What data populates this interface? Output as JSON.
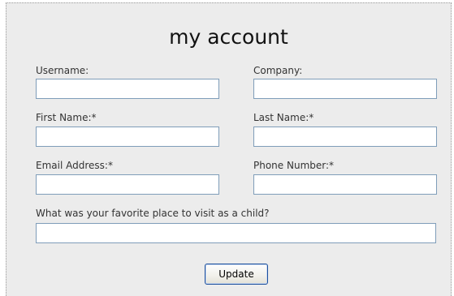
{
  "form": {
    "title": "my account",
    "fields": {
      "username": {
        "label": "Username:",
        "value": ""
      },
      "company": {
        "label": "Company:",
        "value": ""
      },
      "first_name": {
        "label": "First Name:*",
        "value": ""
      },
      "last_name": {
        "label": "Last Name:*",
        "value": ""
      },
      "email": {
        "label": "Email Address:*",
        "value": ""
      },
      "phone": {
        "label": "Phone Number:*",
        "value": ""
      },
      "security_question": {
        "label": "What was your favorite place to visit as a child?",
        "value": ""
      }
    },
    "submit_label": "Update"
  }
}
